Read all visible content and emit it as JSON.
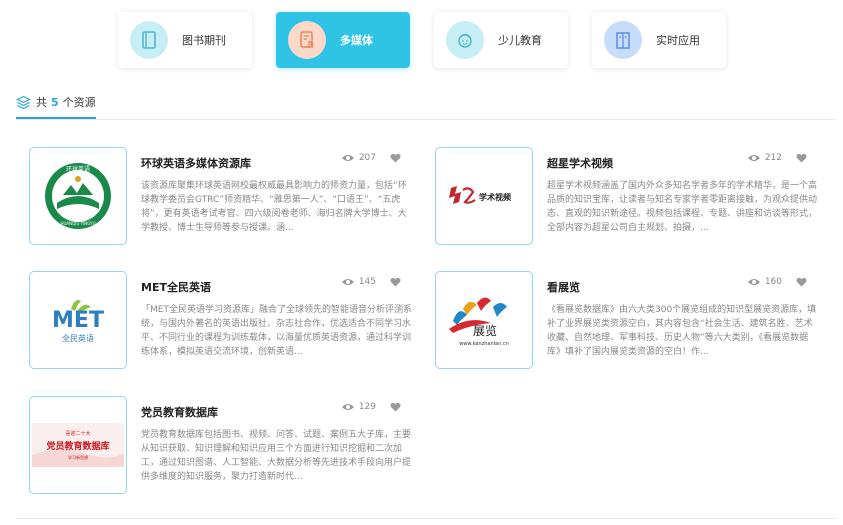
{
  "tabs": [
    {
      "label": "图书期刊",
      "icon": "book-icon",
      "active": false,
      "color": "#c8eef5"
    },
    {
      "label": "多媒体",
      "icon": "multimedia-icon",
      "active": true,
      "color": "#fbd9c8"
    },
    {
      "label": "少儿教育",
      "icon": "child-icon",
      "active": false,
      "color": "#c8eef5"
    },
    {
      "label": "实时应用",
      "icon": "door-icon",
      "active": false,
      "color": "#c8dcfb"
    }
  ],
  "count": {
    "prefix": "共",
    "number": "5",
    "suffix": "个资源"
  },
  "resources": [
    {
      "title": "环球英语多媒体资源库",
      "views": "207",
      "desc": "该资源库聚集环球英语网校最权威最具影响力的师资力量，包括“环球教学委员会GTRC”师资精华、“雅思第一人”、“口语王”、“五虎将”，更有英语考试考官、四六级阅卷老师、海归名牌大学博士、大学教授、博士生导师等参与授课。涵..."
    },
    {
      "title": "超星学术视频",
      "views": "212",
      "desc": "超星学术视频涵盖了国内外众多知名学者多年的学术精华，是一个高品质的知识宝库，让读者与知名专家学者零距离接触，为观众提供动态、直观的知识新途径。视频包括课程、专题、讲座和访谈等形式，全部内容为超星公司自主规划、拍摄，..."
    },
    {
      "title": "MET全民英语",
      "views": "145",
      "desc": "「MET全民英语学习资源库」融合了全球领先的智能语音分析评测系统，与国内外著名的英语出版社、杂志社合作，优选适合不同学习水平、不同行业的课程为训练载体，以海量优质英语资源，通过科学训练体系，模拟英语交流环境，创新英语..."
    },
    {
      "title": "看展览",
      "views": "160",
      "desc": "《看展览数据库》由六大类300个展览组成的知识型展览资源库，填补了业界展览类资源空白，其内容包含“社会生活、建筑名胜、艺术收藏、自然地理、军事科技、历史人物”等六大类别，《看展览数据库》填补了国内展览类资源的空白！作..."
    },
    {
      "title": "党员教育数据库",
      "views": "129",
      "desc": "党员教育数据库包括图书、视频、问答、试题、案例五大子库，主要从知识获取、知识理解和知识应用三个方面进行知识挖掘和二次加工，通过知识图谱、人工智能、大数据分析等先进技术手段向用户提供多维度的知识服务，聚力打造新时代..."
    }
  ],
  "logos": {
    "globe_text": "环球英语",
    "globe_sub": "HUANQIU YINGYU",
    "chaoxing_text": "学术视频",
    "met_text": "MET",
    "met_sub": "全民英语",
    "kzl_text": "展览",
    "kzl_url": "www.kanzhanlan.cn",
    "party_top": "喜迎二十大",
    "party_main": "党员教育数据库",
    "party_sub": "学习新思想"
  }
}
